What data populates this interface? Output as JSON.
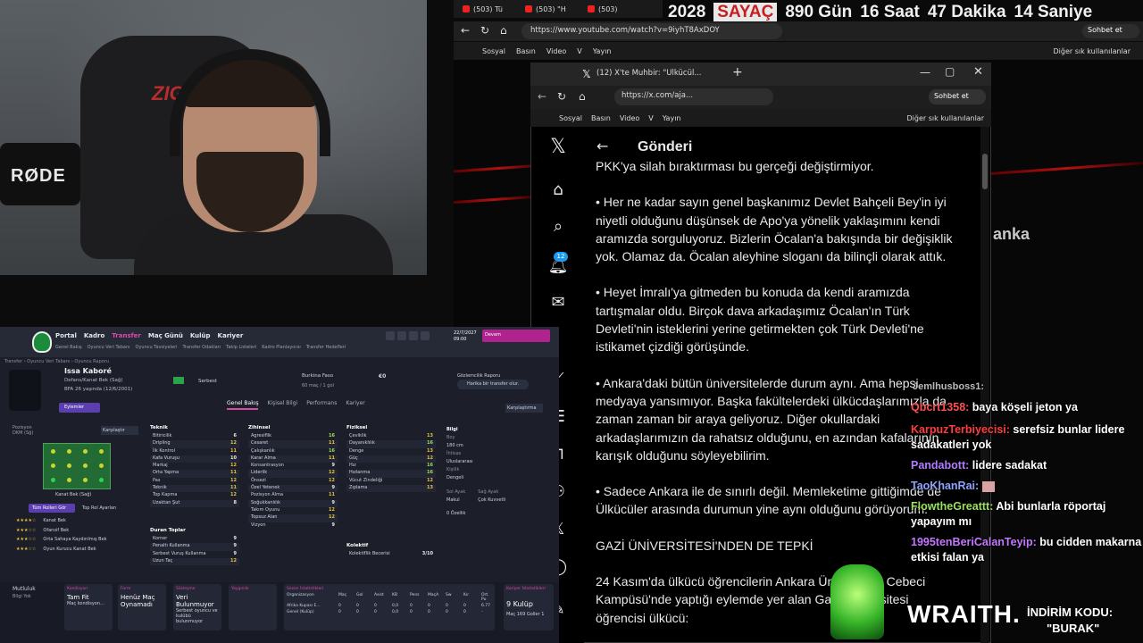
{
  "webcam": {
    "mic_brand": "RØDE",
    "chair_brand": "ZIG"
  },
  "browser": {
    "tabs": [
      "(503) Tü",
      "(503) \"H",
      "(503)"
    ],
    "countdown": {
      "year": "2028",
      "label": "SAYAÇ",
      "days": "890 Gün",
      "hours": "16 Saat",
      "minutes": "47 Dakika",
      "seconds": "14 Saniye"
    },
    "url": "https://www.youtube.com/watch?v=9iyhT8AxDOY",
    "chat_button": "Sohbet et",
    "bookmarks": [
      "Sosyal",
      "Basın",
      "Video",
      "V",
      "Yayın"
    ],
    "other_bookmarks": "Diğer sık kullanılanlar",
    "video_overlay_text": "anka"
  },
  "xwindow": {
    "tab_title": "(12) X'te Muhbir: \"Ülkücül...",
    "url": "https://x.com/aja...",
    "chat_button": "Sohbet et",
    "bookmarks": [
      "Sosyal",
      "Basın",
      "Video",
      "V",
      "Yayın"
    ],
    "other_bookmarks": "Diğer sık kullanılanlar",
    "notification_count": "12",
    "header": "Gönderi",
    "post_lines": [
      "PKK'ya silah bıraktırması bu gerçeği değiştirmiyor.",
      "",
      "• Her ne kadar sayın genel başkanımız Devlet Bahçeli Bey'in iyi",
      "niyetli olduğunu düşünsek de Apo'ya yönelik yaklaşımını kendi",
      "aramızda sorguluyoruz. Bizlerin Öcalan'a bakışında bir değişiklik",
      "yok. Olamaz da. Öcalan aleyhine sloganı da bilinçli olarak attık.",
      "",
      "• Heyet İmralı'ya gitmeden bu konuda da kendi aramızda",
      "tartışmalar oldu. Birçok dava arkadaşımız Öcalan'ın Türk",
      "Devleti'nin isteklerini yerine getirmekten çok Türk Devleti'ne",
      "istikamet çizdiği görüşünde.",
      "",
      "• Ankara'daki bütün üniversitelerde durum aynı. Ama hepsi",
      "medyaya yansımıyor. Başka fakültelerdeki ülkücdaşlarımızla da",
      "zaman zaman bir araya geliyoruz. Diğer okullardaki",
      "arkadaşlarımızın da rahatsız olduğunu, en azından kafalarının",
      "karışık olduğunu söyleyebilirim.",
      "",
      "• Sadece Ankara ile de sınırlı değil. Memleketime gittiğimde de",
      "Ülkücüler arasında durumun yine aynı olduğunu görüyorum.",
      "",
      "GAZİ ÜNİVERSİTESİ'NDEN DE TEPKİ",
      "",
      "24 Kasım'da ülkücü öğrencilerin Ankara Üniversitesi Cebeci",
      "Kampüsü'nde  yaptığı eylemde yer alan Gazi Üniversitesi",
      "öğrencisi ülkücü:"
    ]
  },
  "chat": {
    "partial_user": "Jemlhusboss1:",
    "messages": [
      {
        "user": "Qbcrt1358:",
        "text": "baya köşeli jeton ya"
      },
      {
        "user": "KarpuzTerbiyecisi:",
        "text": "serefsiz bunlar lidere sadakatleri yok"
      },
      {
        "user": "Pandabott:",
        "text": "lidere sadakat"
      },
      {
        "user": "TaoKhanRai:",
        "text": ""
      },
      {
        "user": "FlowtheGreattt:",
        "text": "Abi bunlarla röportaj yapayım mı"
      },
      {
        "user": "1995tenBeriCalanTeyip:",
        "text": "bu cidden makarna etkisi falan ya"
      }
    ]
  },
  "sponsor": {
    "brand": "WRAITH.",
    "discount_label": "İNDİRİM KODU:",
    "code": "\"BURAK\""
  },
  "fm": {
    "nav": [
      "Portal",
      "Kadro",
      "Transfer",
      "Maç Günü",
      "Kulüp",
      "Kariyer"
    ],
    "active_nav": "Transfer",
    "subnav": [
      "Genel Bakış",
      "Oyuncu Veri Tabanı",
      "Oyuncu Tavsiyeleri",
      "Transfer Odakları",
      "Takip Listeleri",
      "Kadro Planlayıcısı",
      "Transfer Hedefleri"
    ],
    "date": "22/7/2027 09:00",
    "continue_label": "Devam",
    "breadcrumb": "Transfer › Oyuncu Veri Tabanı › Oyuncu Raporu",
    "player_name": "Issa Kaboré",
    "position": "Defans/Kanat Bek (Sağ)",
    "age": "BFA   26 yaşında (12/6/2001)",
    "status": "Serbest",
    "club": "Burkina Faso",
    "club_caps": "60 maç / 1 gol",
    "value": "€0",
    "scout_title": "Gözlemcilik Raporu",
    "scout_text": "Harika bir transfer olur.",
    "actions": "Eylemler",
    "tabs": [
      "Genel Bakış",
      "Kişisel Bilgi",
      "Performans",
      "Kariyer"
    ],
    "compare": "Karşılaştırma",
    "position_label": "Pozisyon DKM (Sğ)",
    "compare_btn": "Karşılaştır",
    "pitch_label": "Kanat Bek (Sağ)",
    "role_primary": "Tüm Rolleri Gör",
    "role_secondary": "Top Rol Ayarları",
    "roles": [
      {
        "stars": "★★★★☆",
        "name": "Kanat Bek"
      },
      {
        "stars": "★★★☆☆",
        "name": "Ofansif Bek"
      },
      {
        "stars": "★★★☆☆",
        "name": "Orta Sahaya Kaydırılmış Bek"
      },
      {
        "stars": "★★★☆☆",
        "name": "Oyun Kurucu Kanat Bek"
      }
    ],
    "teknik": {
      "title": "Teknik",
      "rows": [
        [
          "Bitiricilik",
          "6"
        ],
        [
          "Dripling",
          "12"
        ],
        [
          "İlk Kontrol",
          "11"
        ],
        [
          "Kafa Vuruşu",
          "10"
        ],
        [
          "Markaj",
          "12"
        ],
        [
          "Orta Yapma",
          "11"
        ],
        [
          "Pas",
          "12"
        ],
        [
          "Teknik",
          "11"
        ],
        [
          "Top Kapma",
          "12"
        ],
        [
          "Uzaktan Şut",
          "8"
        ]
      ]
    },
    "duran": {
      "title": "Duran Toplar",
      "rows": [
        [
          "Korner",
          "9"
        ],
        [
          "Penaltı Kullanma",
          "9"
        ],
        [
          "Serbest Vuruş Kullanma",
          "9"
        ],
        [
          "Uzun Taç",
          "12"
        ]
      ]
    },
    "zihinsel": {
      "title": "Zihinsel",
      "rows": [
        [
          "Agresiflik",
          "16"
        ],
        [
          "Cesaret",
          "11"
        ],
        [
          "Çalışkanlık",
          "16"
        ],
        [
          "Karar Alma",
          "11"
        ],
        [
          "Konsantrasyon",
          "9"
        ],
        [
          "Liderlik",
          "12"
        ],
        [
          "Önsezi",
          "12"
        ],
        [
          "Özel Yetenek",
          "9"
        ],
        [
          "Pozisyon Alma",
          "11"
        ],
        [
          "Soğukkanlılık",
          "9"
        ],
        [
          "Takım Oyunu",
          "12"
        ],
        [
          "Topsuz Alan",
          "12"
        ],
        [
          "Vizyon",
          "9"
        ]
      ]
    },
    "fiziksel": {
      "title": "Fiziksel",
      "rows": [
        [
          "Çeviklik",
          "13"
        ],
        [
          "Dayanıklılık",
          "16"
        ],
        [
          "Denge",
          "13"
        ],
        [
          "Güç",
          "12"
        ],
        [
          "Hız",
          "16"
        ],
        [
          "Hızlanma",
          "16"
        ],
        [
          "Vücut Zindeliği",
          "12"
        ],
        [
          "Zıplama",
          "13"
        ]
      ]
    },
    "info": {
      "title": "Bilgi",
      "height_label": "Boy",
      "height": "180 cm",
      "foot_label": "Ayak",
      "caps_label": "İhtisas",
      "caps": "Uluslararası",
      "char_label": "Kişilik",
      "char": "Dengeli",
      "left_label": "Sol Ayak",
      "left": "Makul",
      "right_label": "Sağ Ayak",
      "right": "Çok Kuvvetli",
      "traits": "0 Özellik"
    },
    "kolektif": {
      "title": "Kolektif",
      "row": "Kolektiflik Becerisi",
      "val": "3/10"
    },
    "moral_title": "Mutluluk",
    "moral": "Bilgi Yok",
    "cards": [
      {
        "title": "Kondisyon",
        "value": "Tam Fit",
        "sub": "Maç kondisyon..."
      },
      {
        "title": "Form",
        "value": "Henüz Maç Oynamadı",
        "sub": ""
      },
      {
        "title": "Sözleşme",
        "value": "Veri Bulunmuyor",
        "sub": "Serbest oyuncu ve kulübü bulunmuyor"
      },
      {
        "title": "Yaygınlık",
        "value": "",
        "sub": ""
      }
    ],
    "stats_title": "Sezon İstatistikleri",
    "stats_head": [
      "Organizasyon",
      "Maç",
      "Gol",
      "Asist",
      "KB",
      "Pens",
      "MaçA",
      "Sw",
      "Kır",
      "Ort. Pu"
    ],
    "stats_rows": [
      [
        "Afrika Kupası E...",
        "0",
        "0",
        "0",
        "0,0",
        "0",
        "0",
        "0",
        "0",
        "6.77"
      ],
      [
        "Genel (Kulüp)",
        "0",
        "0",
        "0",
        "0,0",
        "0",
        "0",
        "0",
        "0",
        "-"
      ]
    ],
    "career_title": "Kariyer İstatistikleri",
    "career_value": "9 Kulüp",
    "career_foot": "Maç 169  Goller 1"
  }
}
